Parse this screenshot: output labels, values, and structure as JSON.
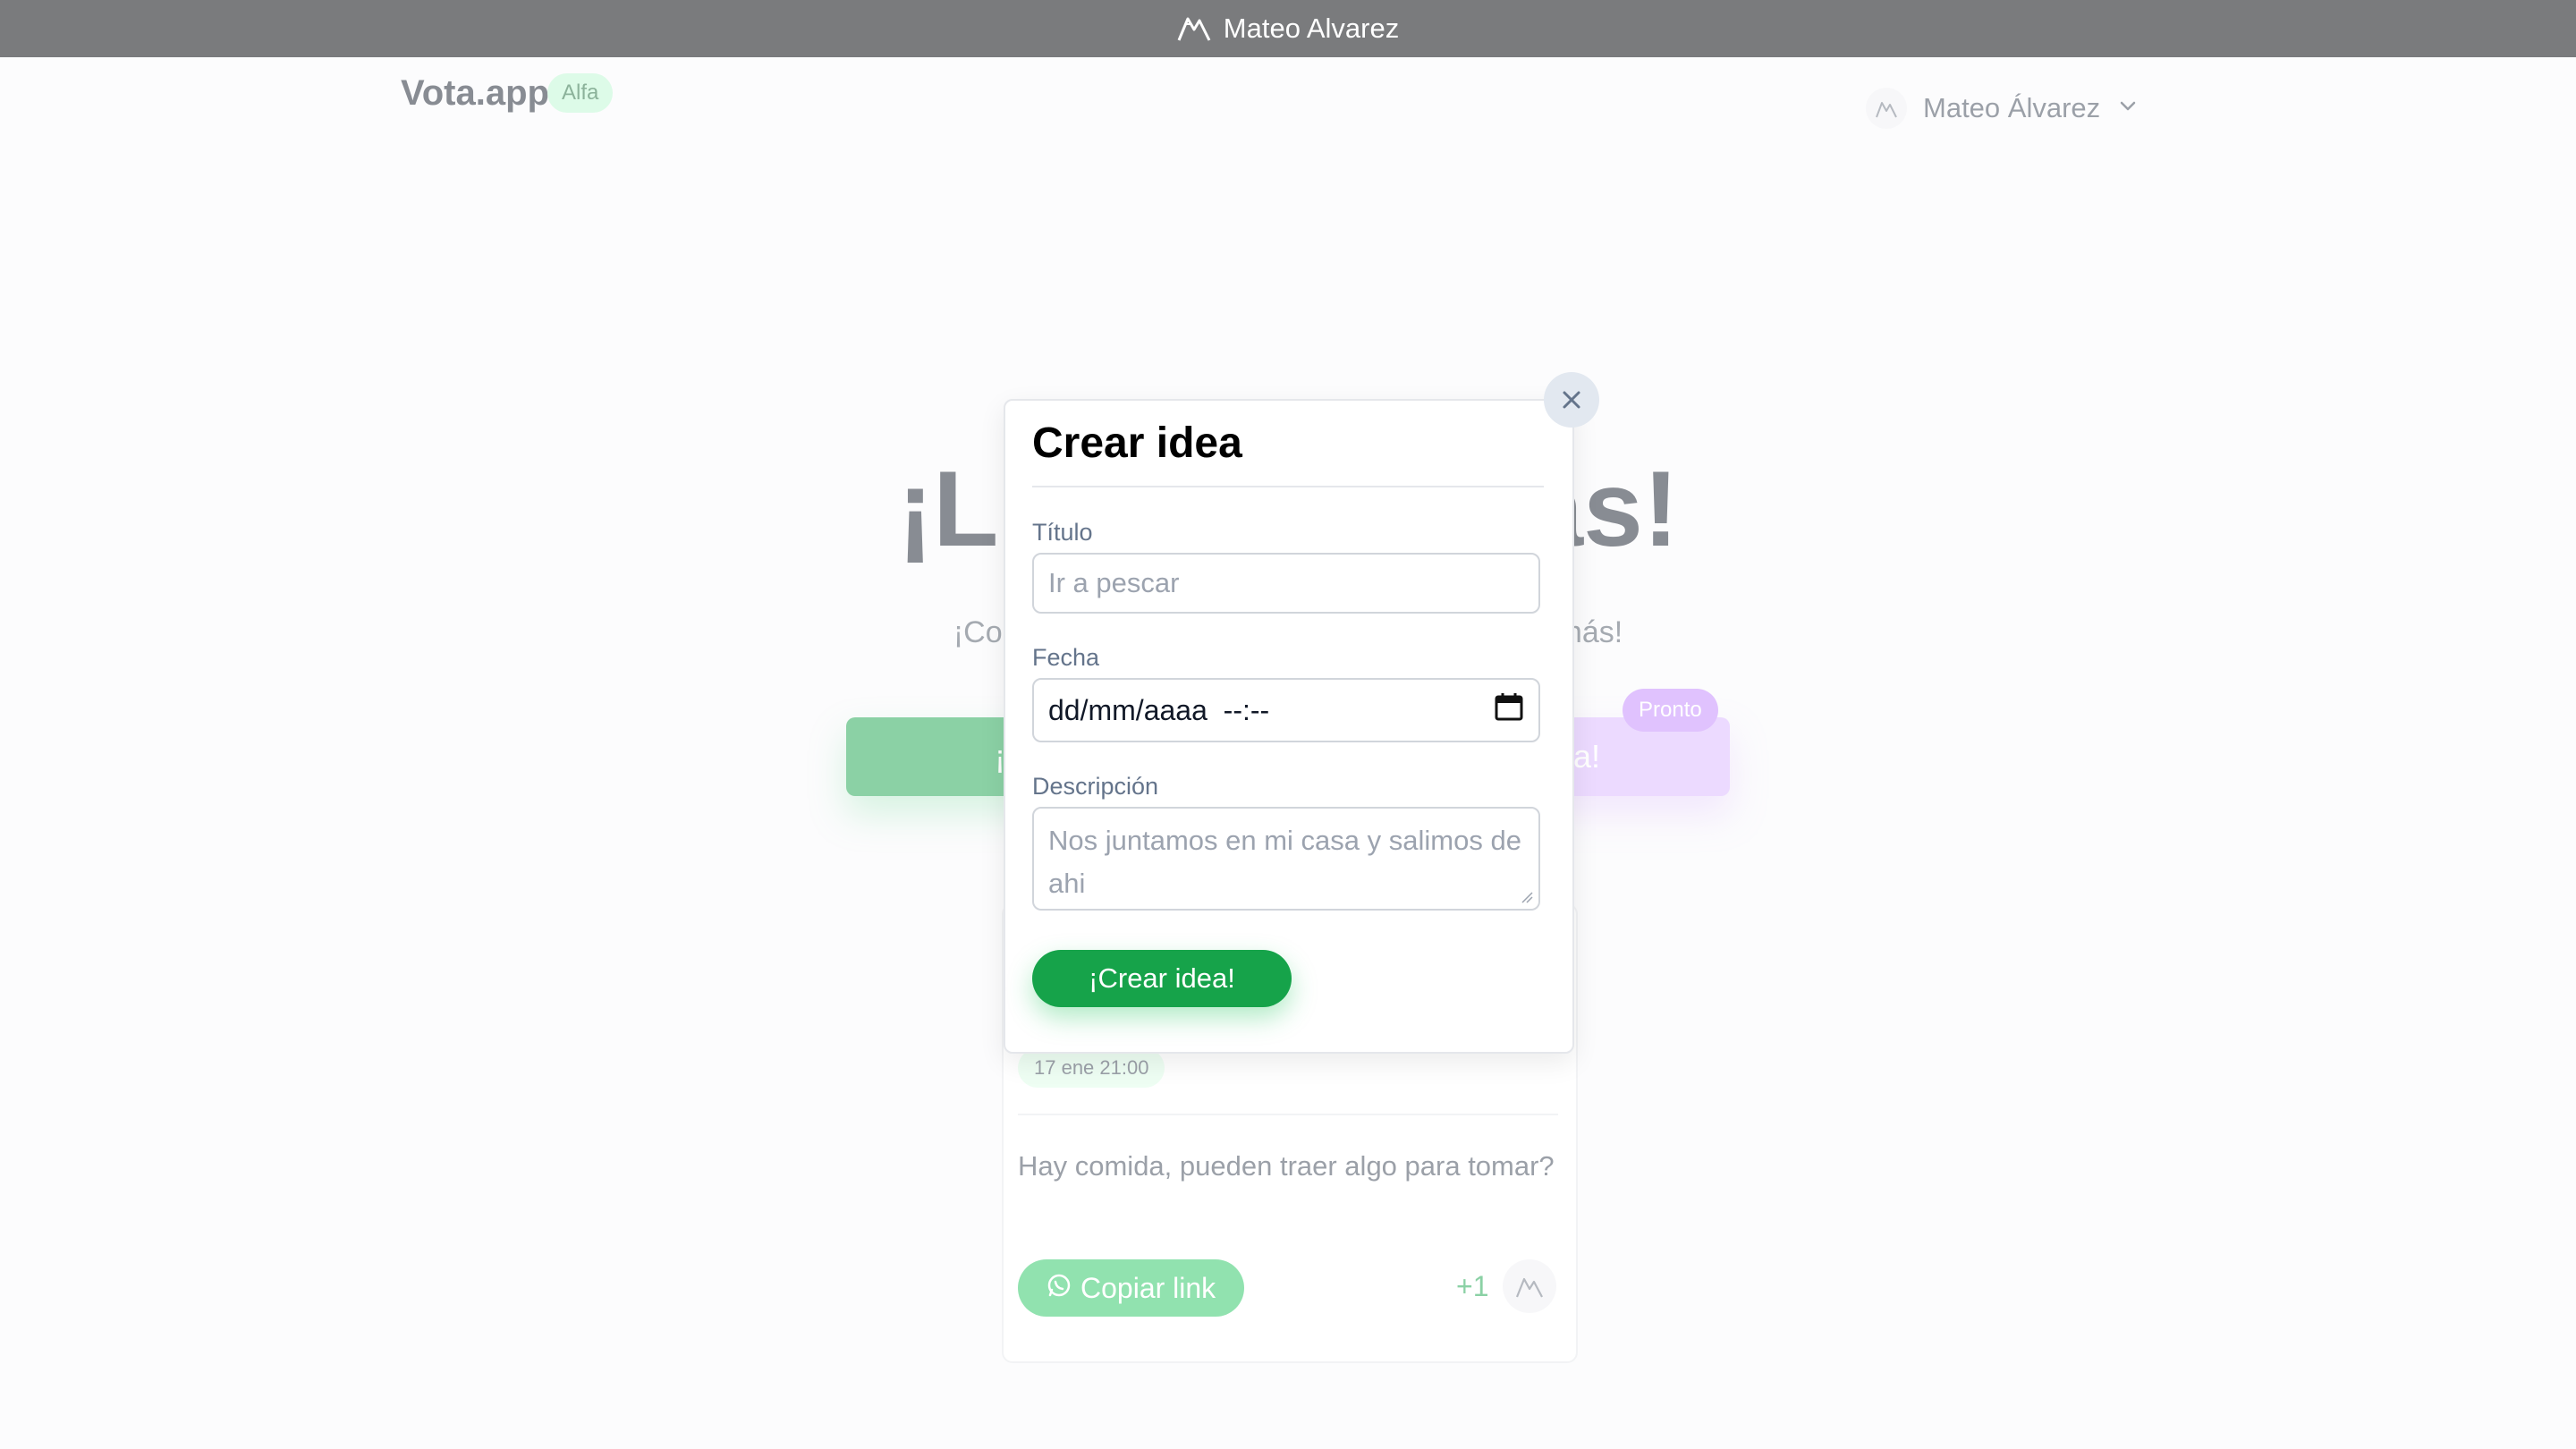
{
  "window": {
    "title": "Mateo Alvarez",
    "icon": "mountain-icon"
  },
  "header": {
    "brand": "Vota.app",
    "brand_badge": "Alfa",
    "user_name": "Mateo Álvarez",
    "user_icon": "mountain-icon",
    "menu_icon": "chevron-down-icon"
  },
  "hero": {
    "title": "¡Lista de ideas!",
    "subtitle": "¡Compartí tus ideas y votá las que te gustan más!",
    "create_button": "¡Crear idea!",
    "join_button": "¡Unirse a idea!",
    "join_badge": "Pronto"
  },
  "idea_card": {
    "date": "17 ene 21:00",
    "description": "Hay comida, pueden traer algo para tomar?",
    "copy_link": "Copiar link",
    "copy_icon": "whatsapp-icon",
    "votes": "+1"
  },
  "modal": {
    "title": "Crear idea",
    "close_icon": "close-icon",
    "fields": {
      "title_label": "Título",
      "title_placeholder": "Ir a pescar",
      "date_label": "Fecha",
      "date_value": "dd/mm/aaaa  --:--",
      "date_icon": "calendar-icon",
      "description_label": "Descripción",
      "description_placeholder": "Nos juntamos en mi casa y salimos de ahi"
    },
    "submit": "¡Crear idea!"
  },
  "colors": {
    "primary": "#16a34a",
    "secondary": "#c084fc",
    "topbar": "#7a7b7d"
  }
}
